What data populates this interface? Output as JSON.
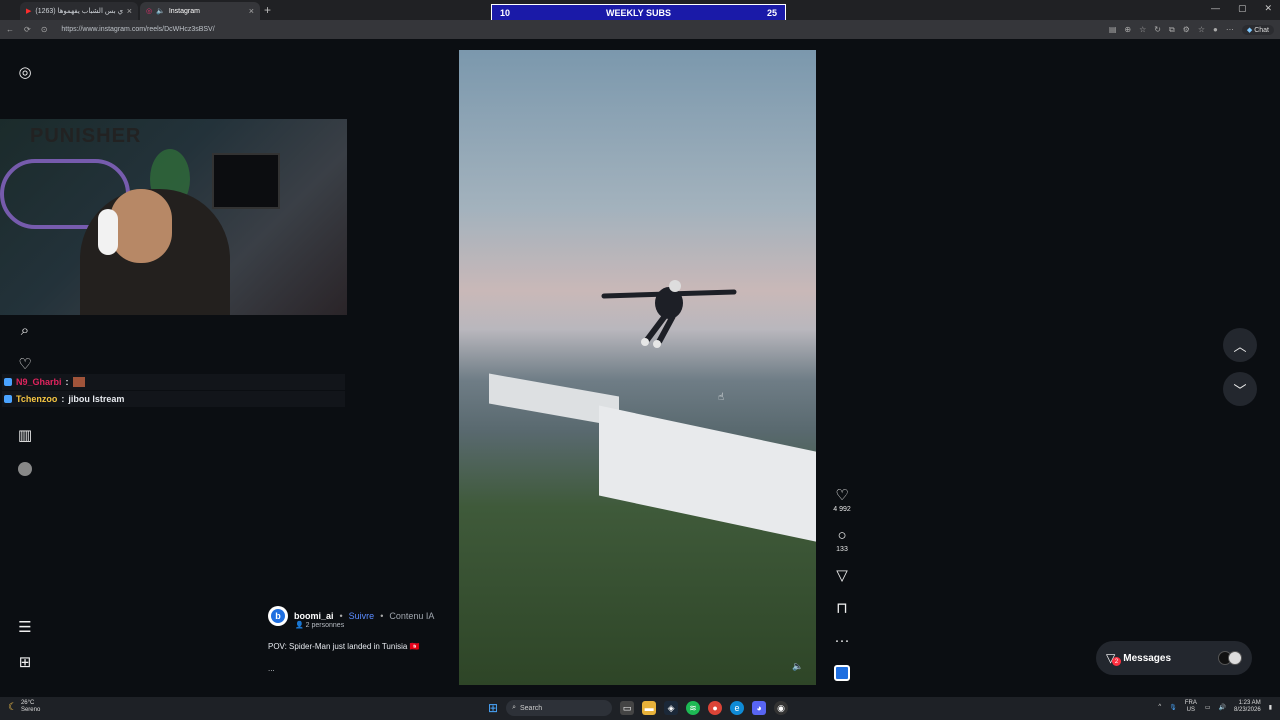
{
  "browser": {
    "tabs": [
      {
        "label": "(1263) هاي بس الشباب يفهموها😂",
        "icon": "youtube-icon"
      },
      {
        "label": "Instagram",
        "icon": "instagram-icon"
      }
    ],
    "new_tab": "+",
    "url": "https://www.instagram.com/reels/DcWHcz3sBSV/",
    "chat_label": "Chat",
    "window_controls": [
      "—",
      "▢",
      "✕"
    ]
  },
  "overlay": {
    "subs_left": "10",
    "subs_title": "WEEKLY SUBS",
    "subs_right": "25",
    "chat": [
      {
        "user": "N9_Gharbi",
        "sep": ":",
        "msg": "",
        "color": "#e0245e"
      },
      {
        "user": "Tchenzoo",
        "sep": ":",
        "msg": "jibou lstream",
        "color": "#f5c542"
      }
    ],
    "webcam_sign": "PUNISHER"
  },
  "sidebar": {
    "icons": [
      "instagram-icon",
      "search-icon",
      "heart-icon",
      "dashboard-icon",
      "profile-avatar",
      "menu-icon",
      "apps-icon"
    ]
  },
  "reel": {
    "author": "boomi_ai",
    "separator": "•",
    "follow": "Suivre",
    "ai_label": "Contenu IA",
    "people": "2 personnes",
    "caption": "POV: Spider-Man just landed in Tunisia 🇹🇳",
    "caption_extra": "...",
    "likes": "4 992",
    "comments": "133",
    "more": "···"
  },
  "messages": {
    "label": "Messages",
    "badge": "2"
  },
  "taskbar": {
    "temp": "26°C",
    "weather": "Sereno",
    "search": "Search",
    "lang": "FRA",
    "region": "US",
    "time": "1:23 AM",
    "date": "8/23/2026"
  },
  "colors": {
    "subs_bg": "#1a1aa8",
    "follow": "#5b8cff",
    "badge": "#ff3040"
  }
}
